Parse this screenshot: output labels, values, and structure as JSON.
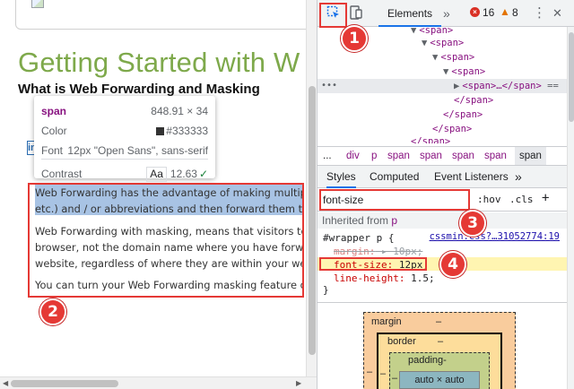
{
  "page": {
    "title": "Getting Started with W",
    "heading": "What is Web Forwarding and Masking",
    "paragraph1": [
      "Web Forwarding has the advantage of making multiple",
      "etc.) and / or abbreviations and then forward them to y"
    ],
    "paragraph2": [
      "Web Forwarding with masking, means that visitors to y",
      "browser, not the domain name where you have forward",
      "website, regardless of where they are within your websi"
    ],
    "paragraph3": "You can turn your Web Forwarding masking feature on",
    "linkedin_letters": "in"
  },
  "tooltip": {
    "tag": "span",
    "dimensions": "848.91 × 34",
    "color_label": "Color",
    "color_value": "#333333",
    "font_label": "Font",
    "font_value": "12px \"Open Sans\", sans-serif",
    "contrast_label": "Contrast",
    "contrast_aa": "Aa",
    "contrast_value": "12.63",
    "contrast_check": "✓"
  },
  "devtools": {
    "tab_elements": "Elements",
    "more_tabs": "»",
    "errors": "16",
    "error_glyph": "×",
    "warnings": "8",
    "warning_glyph": "▲",
    "menu": "⋮",
    "close": "✕",
    "dom": [
      "<span>",
      "<span>",
      "<span>",
      "<span>",
      "<span>…</span>",
      "</span>",
      "</span>",
      "</span>",
      "</span>"
    ],
    "dom_dots": "•••",
    "dom_eq": "==",
    "breadcrumbs": [
      "...",
      "div",
      "p",
      "span",
      "span",
      "span",
      "span",
      "span"
    ],
    "sub_tabs": [
      "Styles",
      "Computed",
      "Event Listeners",
      "»"
    ],
    "filter_value": "font-size",
    "hov": ":hov",
    "cls": ".cls",
    "plus": "+",
    "inherited_prefix": "Inherited from",
    "inherited_tag": "p",
    "rule_selector": "#wrapper p {",
    "rule_source": "cssmin.css?…31052774:19",
    "prop1_name": "margin:",
    "prop1_value": "▸ 10px;",
    "prop2_name": "font-size:",
    "prop2_value": "12px;",
    "prop3_name": "line-height:",
    "prop3_value": "1.5;",
    "rule_close": "}",
    "box_model": {
      "margin": "margin",
      "border": "border",
      "padding": "padding-",
      "content": "auto × auto",
      "dash": "–"
    }
  },
  "annotations": [
    "1",
    "2",
    "3",
    "4"
  ],
  "colors": {
    "accent": "#1a73e8",
    "annotation_red": "#e53935",
    "title_green": "#7ea94b",
    "selection_blue": "#a8c3e4",
    "highlight_yellow": "#fff5b1"
  }
}
